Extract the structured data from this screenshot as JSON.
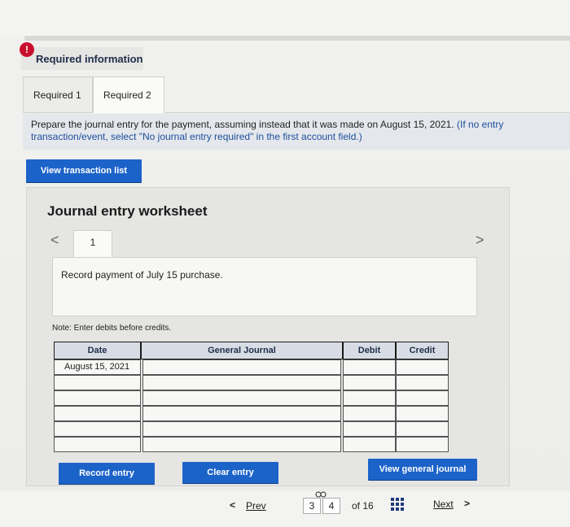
{
  "header": {
    "alert_glyph": "!",
    "title": "Required information"
  },
  "tabs": [
    {
      "label": "Required 1"
    },
    {
      "label": "Required 2"
    }
  ],
  "instruction": {
    "text": "Prepare the journal entry for the payment, assuming instead that it was made on August 15, 2021.",
    "hint": "(If no entry transaction/event, select \"No journal entry required\" in the first account field.)"
  },
  "buttons": {
    "view_transactions": "View transaction list",
    "record_entry": "Record entry",
    "clear_entry": "Clear entry",
    "view_general_journal": "View general journal"
  },
  "worksheet": {
    "title": "Journal entry worksheet",
    "prev_glyph": "<",
    "next_glyph": ">",
    "current_tab": "1",
    "record_text": "Record payment of July 15 purchase.",
    "note": "Note: Enter debits before credits."
  },
  "journal_table": {
    "headers": {
      "date": "Date",
      "account": "General Journal",
      "debit": "Debit",
      "credit": "Credit"
    },
    "first_date": "August 15, 2021"
  },
  "footer": {
    "prev_label": "Prev",
    "prev_glyph": "<",
    "page_current": "3",
    "page_next": "4",
    "of_label": "of 16",
    "next_label": "Next",
    "next_glyph": ">"
  },
  "colors": {
    "primary_button": "#1c63c9",
    "alert": "#c8102e",
    "header_fill": "#d8dde5"
  },
  "icons": [
    "alert-icon",
    "chevron-left-icon",
    "chevron-right-icon",
    "grid-icon",
    "link-icon"
  ]
}
